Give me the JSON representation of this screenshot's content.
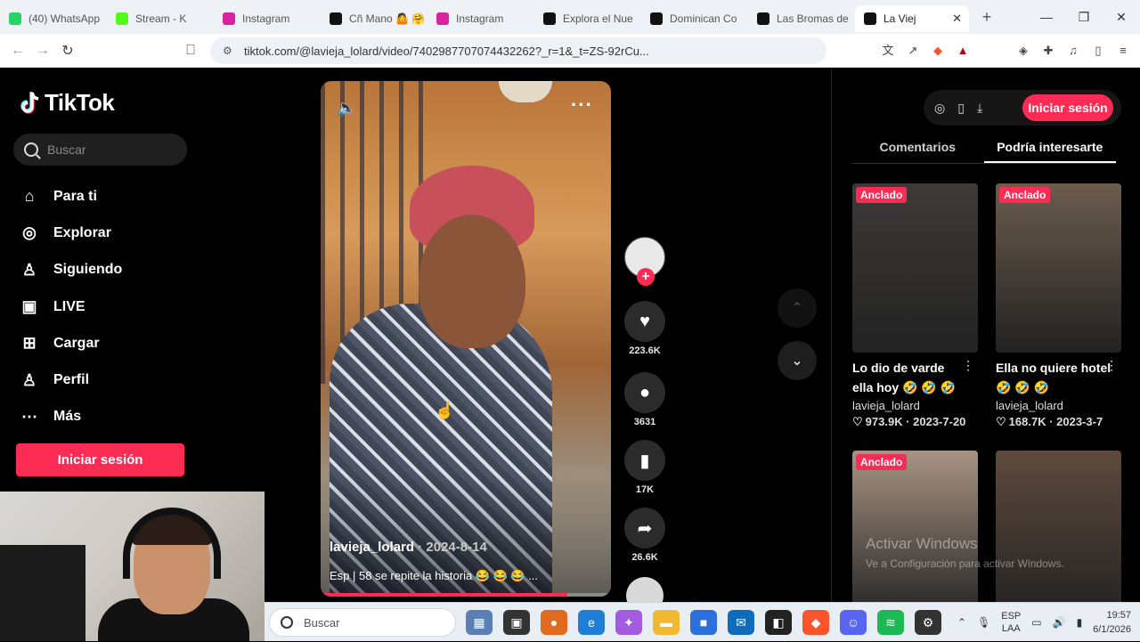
{
  "browser": {
    "tabs": [
      {
        "label": "(40) WhatsApp",
        "color": "#25d366"
      },
      {
        "label": "Stream - K",
        "color": "#53fc18"
      },
      {
        "label": "Instagram",
        "color": "#d6249f"
      },
      {
        "label": "Cñ Mano 🤷 🤗",
        "color": "#111111"
      },
      {
        "label": "Instagram",
        "color": "#d6249f"
      },
      {
        "label": "Explora el Nue",
        "color": "#111111"
      },
      {
        "label": "Dominican Co",
        "color": "#111111"
      },
      {
        "label": "Las Bromas de",
        "color": "#111111"
      },
      {
        "label": "La Viej",
        "color": "#111111",
        "active": true
      }
    ],
    "url": "tiktok.com/@lavieja_lolard/video/7402987707074432262?_r=1&_t=ZS-92rCu..."
  },
  "sidebar": {
    "logo": "TikTok",
    "search_placeholder": "Buscar",
    "items": [
      {
        "label": "Para ti",
        "icon": "home-icon",
        "glyph": "⌂"
      },
      {
        "label": "Explorar",
        "icon": "compass-icon",
        "glyph": "◎"
      },
      {
        "label": "Siguiendo",
        "icon": "following-icon",
        "glyph": "♙"
      },
      {
        "label": "LIVE",
        "icon": "live-icon",
        "glyph": "▣"
      },
      {
        "label": "Cargar",
        "icon": "upload-icon",
        "glyph": "⊞"
      },
      {
        "label": "Perfil",
        "icon": "profile-icon",
        "glyph": "♙"
      },
      {
        "label": "Más",
        "icon": "more-icon",
        "glyph": "⋯"
      }
    ],
    "login_button": "Iniciar sesión"
  },
  "video": {
    "author": "lavieja_lolard",
    "date": "2024-8-14",
    "description": "Esp | 58 se repite la historia 😂 😂 😂 ...",
    "progress": 0.85,
    "likes": "223.6K",
    "comments": "3631",
    "saves": "17K",
    "shares": "26.6K"
  },
  "right_panel": {
    "login_button": "Iniciar sesión",
    "tabs": [
      "Comentarios",
      "Podría interesarte"
    ],
    "active_tab": "Podría interesarte",
    "cards": [
      {
        "badge": "Anclado",
        "title": "Lo dio de varde ella hoy 🤣 🤣 🤣",
        "author": "lavieja_lolard",
        "views": "973.9K",
        "date": "2023-7-20",
        "color": "#3d3a38"
      },
      {
        "badge": "Anclado",
        "title": "Ella no quiere hotel 🤣 🤣 🤣",
        "author": "lavieja_lolard",
        "views": "168.7K",
        "date": "2023-3-7",
        "color": "#6b5c4e"
      },
      {
        "badge": "Anclado",
        "title": "",
        "author": "",
        "views": "",
        "date": "",
        "color": "#a89484"
      },
      {
        "badge": "",
        "title": "",
        "author": "",
        "views": "",
        "date": "",
        "color": "#5e4a3e"
      }
    ],
    "watermark_title": "Activar Windows",
    "watermark_sub": "Ve a Configuración para activar Windows."
  },
  "taskbar": {
    "search_placeholder": "Buscar",
    "lang_top": "ESP",
    "lang_bottom": "LAA",
    "time": "19:57",
    "date": "6/1/2026"
  }
}
